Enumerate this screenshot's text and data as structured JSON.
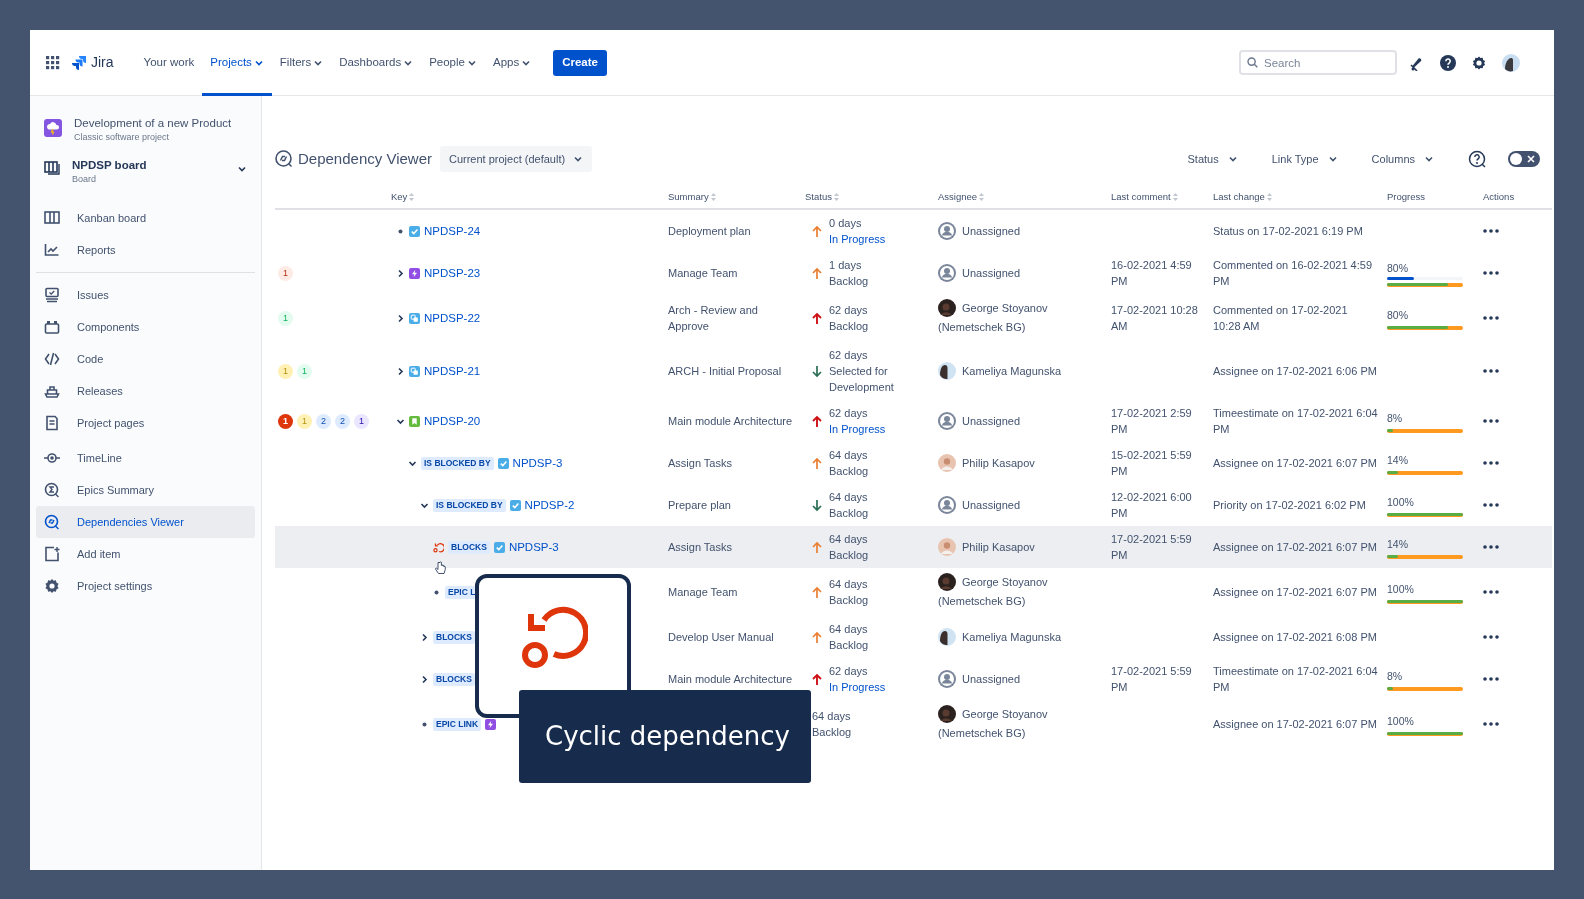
{
  "topnav": {
    "product": "Jira",
    "items": [
      {
        "label": "Your work",
        "selected": false,
        "dropdown": false
      },
      {
        "label": "Projects",
        "selected": true,
        "dropdown": true
      },
      {
        "label": "Filters",
        "selected": false,
        "dropdown": true
      },
      {
        "label": "Dashboards",
        "selected": false,
        "dropdown": true
      },
      {
        "label": "People",
        "selected": false,
        "dropdown": true
      },
      {
        "label": "Apps",
        "selected": false,
        "dropdown": true
      }
    ],
    "create": "Create",
    "search": {
      "placeholder": "Search"
    }
  },
  "sidebar": {
    "project": {
      "name": "Development of a new Product",
      "type": "Classic software project"
    },
    "board": {
      "name": "NPDSP board",
      "subtitle": "Board"
    },
    "sections": [
      [
        {
          "label": "Kanban board",
          "selected": false
        },
        {
          "label": "Reports",
          "selected": false
        }
      ],
      [
        {
          "label": "Issues",
          "selected": false
        },
        {
          "label": "Components",
          "selected": false
        },
        {
          "label": "Code",
          "selected": false
        },
        {
          "label": "Releases",
          "selected": false
        },
        {
          "label": "Project pages",
          "selected": false
        }
      ],
      [
        {
          "label": "TimeLine",
          "selected": false
        },
        {
          "label": "Epics Summary",
          "selected": false
        },
        {
          "label": "Dependencies Viewer",
          "selected": true
        },
        {
          "label": "Add item",
          "selected": false
        },
        {
          "label": "Project settings",
          "selected": false
        }
      ]
    ]
  },
  "toolbar": {
    "title": "Dependency Viewer",
    "scope": "Current project (default)",
    "filters": [
      "Status",
      "Link Type",
      "Columns"
    ],
    "toggle": {
      "on": false
    }
  },
  "table": {
    "columns": [
      {
        "label": "Key",
        "sortable": true
      },
      {
        "label": "Summary",
        "sortable": true
      },
      {
        "label": "Status",
        "sortable": true
      },
      {
        "label": "Assignee",
        "sortable": true
      },
      {
        "label": "Last comment",
        "sortable": true
      },
      {
        "label": "Last change",
        "sortable": true
      },
      {
        "label": "Progress",
        "sortable": false
      },
      {
        "label": "Actions",
        "sortable": false
      }
    ],
    "rows": [
      {
        "badges": [],
        "kind": "bullet",
        "issue_type": {
          "kind": "task"
        },
        "key": "NPDSP-24",
        "summary": "Deployment plan",
        "priority": {
          "kind": "high"
        },
        "days": "0 days",
        "status": "In Progress",
        "in_progress": true,
        "avatar": {
          "kind": "unassigned"
        },
        "assignee": "Unassigned",
        "last_change": "Status on 17-02-2021 6:19 PM",
        "highlighted": false
      },
      {
        "badges": [
          {
            "text": "1",
            "color": "#ffebe6",
            "solid": false
          }
        ],
        "kind": "chevron",
        "expanded": false,
        "issue_type": {
          "kind": "epic"
        },
        "key": "NPDSP-23",
        "summary": "Manage Team",
        "priority": {
          "kind": "high"
        },
        "days": "1 days",
        "status": "Backlog",
        "in_progress": false,
        "avatar": {
          "kind": "unassigned"
        },
        "assignee": "Unassigned",
        "last_comment": "16-02-2021 4:59 PM",
        "last_change": "Commented on 16-02-2021 4:59 PM",
        "progress": {
          "text": "80%",
          "level": 0.8,
          "logged": {
            "level": 0.35
          }
        },
        "highlighted": false
      },
      {
        "badges": [
          {
            "text": "1",
            "color": "#e3fcef",
            "solid": false
          }
        ],
        "kind": "chevron",
        "expanded": false,
        "issue_type": {
          "kind": "subtask"
        },
        "key": "NPDSP-22",
        "summary": "Arch - Review and Approve",
        "priority": {
          "kind": "highest"
        },
        "days": "62 days",
        "status": "Backlog",
        "in_progress": false,
        "avatar": {
          "kind": "photo_dark"
        },
        "assignee": "George Stoyanov (Nemetschek BG)",
        "last_comment": "17-02-2021 10:28 AM",
        "last_change": "Commented on 17-02-2021 10:28 AM",
        "progress": {
          "text": "80%",
          "level": 0.8
        },
        "highlighted": false
      },
      {
        "badges": [
          {
            "text": "1",
            "color": "#fff0b3",
            "solid": false
          },
          {
            "text": "1",
            "color": "#e3fcef",
            "solid": false
          }
        ],
        "kind": "chevron",
        "expanded": false,
        "issue_type": {
          "kind": "subtask"
        },
        "key": "NPDSP-21",
        "summary": "ARCH - Initial Proposal",
        "priority": {
          "kind": "low"
        },
        "days": "62 days",
        "status": "Selected for Development",
        "in_progress": false,
        "avatar": {
          "kind": "photo_light"
        },
        "assignee": "Kameliya Magunska",
        "last_change": "Assignee on 17-02-2021 6:06 PM",
        "highlighted": false
      },
      {
        "badges": [
          {
            "text": "1",
            "color": "#de350b",
            "solid": true
          },
          {
            "text": "1",
            "color": "#fff0b3",
            "solid": false
          },
          {
            "text": "2",
            "color": "#deebff",
            "solid": false
          },
          {
            "text": "2",
            "color": "#deebff",
            "solid": false
          },
          {
            "text": "1",
            "color": "#eae6ff",
            "solid": false
          }
        ],
        "kind": "chevron",
        "expanded": true,
        "issue_type": {
          "kind": "story"
        },
        "key": "NPDSP-20",
        "summary": "Main module Architecture",
        "priority": {
          "kind": "highest"
        },
        "days": "62 days",
        "status": "In Progress",
        "in_progress": true,
        "avatar": {
          "kind": "unassigned"
        },
        "assignee": "Unassigned",
        "last_comment": "17-02-2021 2:59 PM",
        "last_change": "Timeestimate on 17-02-2021 6:04 PM",
        "progress": {
          "text": "8%",
          "level": 0.08
        },
        "highlighted": false,
        "children": [
          {
            "kind": "chevron",
            "expanded": true,
            "link": "IS BLOCKED BY",
            "issue_type": {
              "kind": "task"
            },
            "key": "NPDSP-3",
            "summary": "Assign Tasks",
            "priority": {
              "kind": "high"
            },
            "days": "64 days",
            "status": "Backlog",
            "in_progress": false,
            "avatar": {
              "kind": "photo_warm"
            },
            "assignee": "Philip Kasapov",
            "last_comment": "15-02-2021 5:59 PM",
            "last_change": "Assignee on 17-02-2021 6:07 PM",
            "progress": {
              "text": "14%",
              "level": 0.14
            },
            "highlighted": false,
            "children": [
              {
                "kind": "chevron",
                "expanded": true,
                "link": "IS BLOCKED BY",
                "issue_type": {
                  "kind": "task"
                },
                "key": "NPDSP-2",
                "summary": "Prepare plan",
                "priority": {
                  "kind": "low"
                },
                "days": "64 days",
                "status": "Backlog",
                "in_progress": false,
                "avatar": {
                  "kind": "unassigned"
                },
                "assignee": "Unassigned",
                "last_comment": "12-02-2021 6:00 PM",
                "last_change": "Priority on 17-02-2021 6:02 PM",
                "progress": {
                  "text": "100%",
                  "level": 1
                },
                "highlighted": false,
                "children": [
                  {
                    "kind": "cycle",
                    "link": "BLOCKS",
                    "issue_type": {
                      "kind": "task"
                    },
                    "key": "NPDSP-3",
                    "summary": "Assign Tasks",
                    "priority": {
                      "kind": "high"
                    },
                    "days": "64 days",
                    "status": "Backlog",
                    "in_progress": false,
                    "avatar": {
                      "kind": "photo_warm"
                    },
                    "assignee": "Philip Kasapov",
                    "last_comment": "17-02-2021 5:59 PM",
                    "last_change": "Assignee on 17-02-2021 6:07 PM",
                    "progress": {
                      "text": "14%",
                      "level": 0.14
                    },
                    "highlighted": true
                  },
                  {
                    "kind": "bullet",
                    "link": "EPIC L",
                    "summary": "Manage Team",
                    "priority": {
                      "kind": "high"
                    },
                    "days": "64 days",
                    "status": "Backlog",
                    "in_progress": false,
                    "avatar": {
                      "kind": "photo_dark"
                    },
                    "assignee": "George Stoyanov (Nemetschek BG)",
                    "last_change": "Assignee on 17-02-2021 6:07 PM",
                    "progress": {
                      "text": "100%",
                      "level": 1
                    },
                    "highlighted": false
                  }
                ]
              },
              {
                "kind": "chevron",
                "expanded": false,
                "link": "BLOCKS",
                "summary": "Develop User Manual",
                "priority": {
                  "kind": "high"
                },
                "days": "64 days",
                "status": "Backlog",
                "in_progress": false,
                "avatar": {
                  "kind": "photo_light"
                },
                "assignee": "Kameliya Magunska",
                "last_change": "Assignee on 17-02-2021 6:08 PM",
                "highlighted": false
              },
              {
                "kind": "chevron",
                "expanded": false,
                "link": "BLOCKS",
                "summary": "Main module Architecture",
                "priority": {
                  "kind": "highest"
                },
                "days": "62 days",
                "status": "In Progress",
                "in_progress": true,
                "avatar": {
                  "kind": "unassigned"
                },
                "assignee": "Unassigned",
                "last_comment": "17-02-2021 5:59 PM",
                "last_change": "Timeestimate on 17-02-2021 6:04 PM",
                "progress": {
                  "text": "8%",
                  "level": 0.08
                },
                "highlighted": false
              },
              {
                "kind": "bullet",
                "link": "EPIC LINK",
                "issue_type": {
                  "kind": "epic"
                },
                "days": "64 days",
                "status": "Backlog",
                "in_progress": false,
                "avatar": {
                  "kind": "photo_dark"
                },
                "assignee": "George Stoyanov (Nemetschek BG)",
                "last_change": "Assignee on 17-02-2021 6:07 PM",
                "progress": {
                  "text": "100%",
                  "level": 1
                },
                "highlighted": false
              }
            ]
          }
        ]
      }
    ]
  },
  "callout": {
    "text": "Cyclic dependency"
  }
}
